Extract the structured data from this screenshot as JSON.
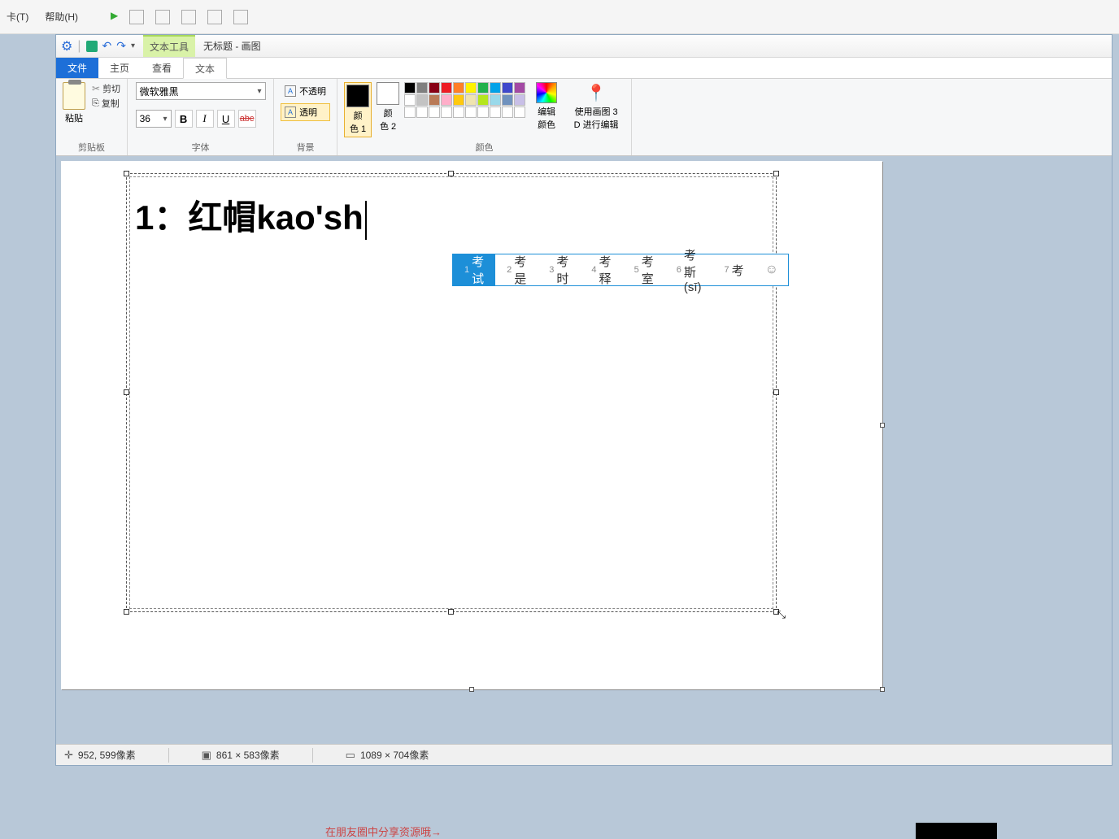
{
  "bg_menu": {
    "item1": "卡(T)",
    "item2": "帮助(H)"
  },
  "titlebar": {
    "text_tool_label": "文本工具",
    "doc_title": "无标题 - 画图"
  },
  "tabs": {
    "file": "文件",
    "home": "主页",
    "view": "查看",
    "text": "文本"
  },
  "clipboard": {
    "paste": "粘贴",
    "cut": "剪切",
    "copy": "复制",
    "group": "剪贴板"
  },
  "font": {
    "name": "微软雅黑",
    "size": "36",
    "bold": "B",
    "italic": "I",
    "underline": "U",
    "strike": "abc",
    "group": "字体"
  },
  "background": {
    "opaque": "不透明",
    "transparent": "透明",
    "group": "背景"
  },
  "colors": {
    "color1": "颜\n色 1",
    "color2": "颜\n色 2",
    "edit": "编辑\n颜色",
    "group": "颜色",
    "row1": [
      "#000000",
      "#7f7f7f",
      "#880015",
      "#ed1c24",
      "#ff7f27",
      "#fff200",
      "#22b14c",
      "#00a2e8",
      "#3f48cc",
      "#a349a4"
    ],
    "row2": [
      "#ffffff",
      "#c3c3c3",
      "#b97a57",
      "#ffaec9",
      "#ffc90e",
      "#efe4b0",
      "#b5e61d",
      "#99d9ea",
      "#7092be",
      "#c8bfe7"
    ],
    "row3": [
      "#ffffff",
      "#ffffff",
      "#ffffff",
      "#ffffff",
      "#ffffff",
      "#ffffff",
      "#ffffff",
      "#ffffff",
      "#ffffff",
      "#ffffff"
    ],
    "c1_swatch": "#000000",
    "c2_swatch": "#ffffff"
  },
  "paint3d": {
    "label": "使用画图 3\nD 进行编辑"
  },
  "canvas": {
    "typed_text": "1：红帽kao'sh"
  },
  "ime": {
    "candidates": [
      {
        "n": "1",
        "t": "考试"
      },
      {
        "n": "2",
        "t": "考是"
      },
      {
        "n": "3",
        "t": "考时"
      },
      {
        "n": "4",
        "t": "考释"
      },
      {
        "n": "5",
        "t": "考室"
      },
      {
        "n": "6",
        "t": "考斯(sī)"
      },
      {
        "n": "7",
        "t": "考"
      }
    ],
    "emoji": "☺"
  },
  "status": {
    "pos": "952, 599像素",
    "sel": "861 × 583像素",
    "size": "1089 × 704像素"
  },
  "bottom_hint": "在朋友圈中分享资源哦→"
}
